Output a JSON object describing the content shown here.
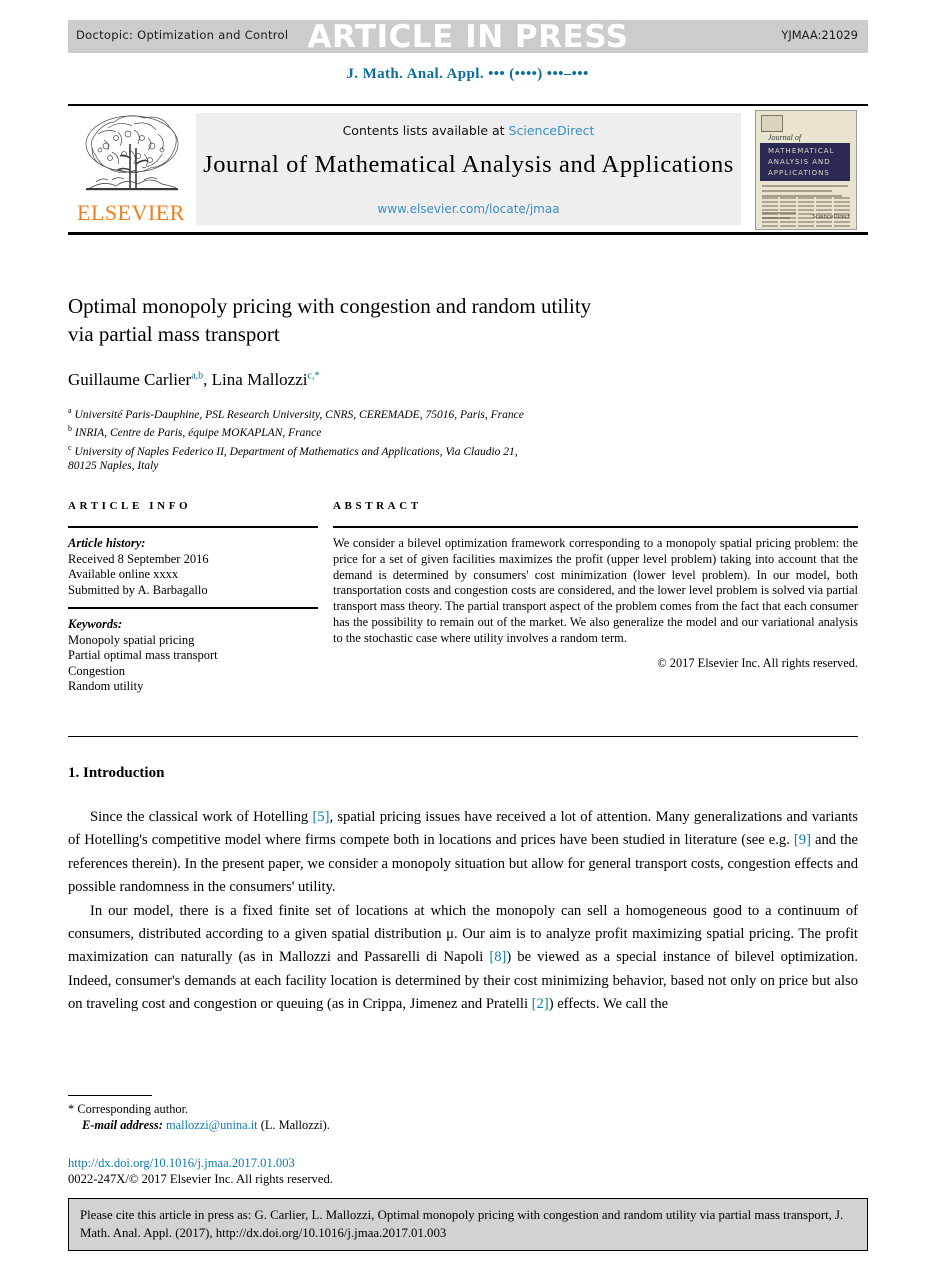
{
  "press_band": {
    "doctopic": "Doctopic: Optimization and Control",
    "title": "ARTICLE IN PRESS",
    "article_id": "YJMAA:21029"
  },
  "running_head": "J. Math. Anal. Appl. ••• (••••) •••–•••",
  "masthead": {
    "contents_prefix": "Contents lists available at ",
    "contents_link": "ScienceDirect",
    "journal_name": "Journal of Mathematical Analysis and Applications",
    "journal_url": "www.elsevier.com/locate/jmaa",
    "publisher": "ELSEVIER",
    "cover": {
      "script_label": "Journal of",
      "band_line_1": "MATHEMATICAL",
      "band_line_2": "ANALYSIS AND",
      "band_line_3": "APPLICATIONS",
      "footer_right": "ScienceDirect"
    }
  },
  "article": {
    "title_line_1": "Optimal monopoly pricing with congestion and random utility",
    "title_line_2": "via partial mass transport",
    "authors": {
      "a1_name": "Guillaume Carlier",
      "a1_sup": "a,b",
      "separator": ", ",
      "a2_name": "Lina Mallozzi",
      "a2_sup": "c,*"
    },
    "affiliations": [
      {
        "marker": "a",
        "text": "Université Paris-Dauphine, PSL Research University, CNRS, CEREMADE, 75016, Paris, France"
      },
      {
        "marker": "b",
        "text": "INRIA, Centre de Paris, équipe MOKAPLAN, France"
      },
      {
        "marker": "c",
        "text": "University of Naples Federico II, Department of Mathematics and Applications, Via Claudio 21,"
      },
      {
        "marker": "",
        "text": "80125 Naples, Italy"
      }
    ]
  },
  "info": {
    "heading": "ARTICLE INFO",
    "history_label": "Article history:",
    "history": [
      "Received 8 September 2016",
      "Available online xxxx",
      "Submitted by A. Barbagallo"
    ],
    "keywords_label": "Keywords:",
    "keywords": [
      "Monopoly spatial pricing",
      "Partial optimal mass transport",
      "Congestion",
      "Random utility"
    ]
  },
  "abstract": {
    "heading": "ABSTRACT",
    "text": "We consider a bilevel optimization framework corresponding to a monopoly spatial pricing problem: the price for a set of given facilities maximizes the profit (upper level problem) taking into account that the demand is determined by consumers' cost minimization (lower level problem). In our model, both transportation costs and congestion costs are considered, and the lower level problem is solved via partial transport mass theory. The partial transport aspect of the problem comes from the fact that each consumer has the possibility to remain out of the market. We also generalize the model and our variational analysis to the stochastic case where utility involves a random term.",
    "copyright": "© 2017 Elsevier Inc. All rights reserved."
  },
  "body": {
    "section_heading": "1. Introduction",
    "paragraph_1": {
      "part_1": "Since the classical work of Hotelling ",
      "ref_1": "[5]",
      "part_2": ", spatial pricing issues have received a lot of attention. Many generalizations and variants of Hotelling's competitive model where firms compete both in locations and prices have been studied in literature (see e.g. ",
      "ref_2": "[9]",
      "part_3": " and the references therein). In the present paper, we consider a monopoly situation but allow for general transport costs, congestion effects and possible randomness in the consumers' utility."
    },
    "paragraph_2": {
      "part_1": "In our model, there is a fixed finite set of locations at which the monopoly can sell a homogeneous good to a continuum of consumers, distributed according to a given spatial distribution μ. Our aim is to analyze profit maximizing spatial pricing. The profit maximization can naturally (as in Mallozzi and Passarelli di Napoli ",
      "ref_1": "[8]",
      "part_2": ") be viewed as a special instance of bilevel optimization. Indeed, consumer's demands at each facility location is determined by their cost minimizing behavior, based not only on price but also on traveling cost and congestion or queuing (as in Crippa, Jimenez and Pratelli ",
      "ref_2": "[2]",
      "part_3": ") effects. We call the"
    }
  },
  "footnote": {
    "marker": "*",
    "corresponding": "Corresponding author.",
    "email_label": "E-mail address:",
    "email": "mallozzi@unina.it",
    "email_suffix": "(L. Mallozzi).",
    "doi": "http://dx.doi.org/10.1016/j.jmaa.2017.01.003",
    "issn_line": "0022-247X/© 2017 Elsevier Inc. All rights reserved."
  },
  "cite_box": {
    "text": "Please cite this article in press as: G. Carlier, L. Mallozzi, Optimal monopoly pricing with congestion and random utility via partial mass transport, J. Math. Anal. Appl. (2017), http://dx.doi.org/10.1016/j.jmaa.2017.01.003"
  },
  "colors": {
    "link": "#0b7bb5",
    "sciencedirect": "#3a8fc4",
    "running_head": "#0b6e99",
    "elsevier_orange": "#ef7d1a",
    "band_gray": "#cccccc",
    "cover_navy": "#2b2a55",
    "cover_cream": "#e8e4cf"
  }
}
